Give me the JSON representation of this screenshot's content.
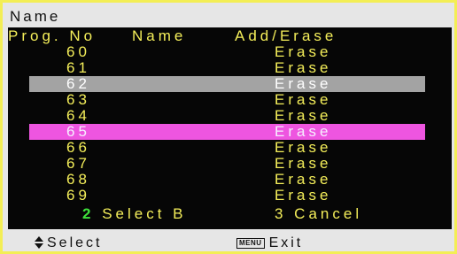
{
  "window": {
    "title": "Name"
  },
  "columns": {
    "prog_no": "Prog. No",
    "name": "Name",
    "add_erase": "Add/Erase"
  },
  "rows": [
    {
      "prog": "60",
      "action": "Erase",
      "state": "normal"
    },
    {
      "prog": "61",
      "action": "Erase",
      "state": "normal"
    },
    {
      "prog": "62",
      "action": "Erase",
      "state": "selected"
    },
    {
      "prog": "63",
      "action": "Erase",
      "state": "normal"
    },
    {
      "prog": "64",
      "action": "Erase",
      "state": "normal"
    },
    {
      "prog": "65",
      "action": "Erase",
      "state": "highlighted"
    },
    {
      "prog": "66",
      "action": "Erase",
      "state": "normal"
    },
    {
      "prog": "67",
      "action": "Erase",
      "state": "normal"
    },
    {
      "prog": "68",
      "action": "Erase",
      "state": "normal"
    },
    {
      "prog": "69",
      "action": "Erase",
      "state": "normal"
    }
  ],
  "buttons": {
    "select_b_number": "2",
    "select_b_label": "Select B",
    "cancel_label": "3 Cancel"
  },
  "status": {
    "select_icon": "up-down-arrow-icon",
    "select_label": "Select",
    "menu_key_label": "MENU",
    "exit_label": "Exit"
  },
  "colors": {
    "border": "#f3ee55",
    "panel_bg": "#060606",
    "text_yellow": "#f5ef5a",
    "selected_row": "#a3a3a3",
    "highlight_row": "#ee55e0",
    "green_number": "#3ee23b"
  }
}
